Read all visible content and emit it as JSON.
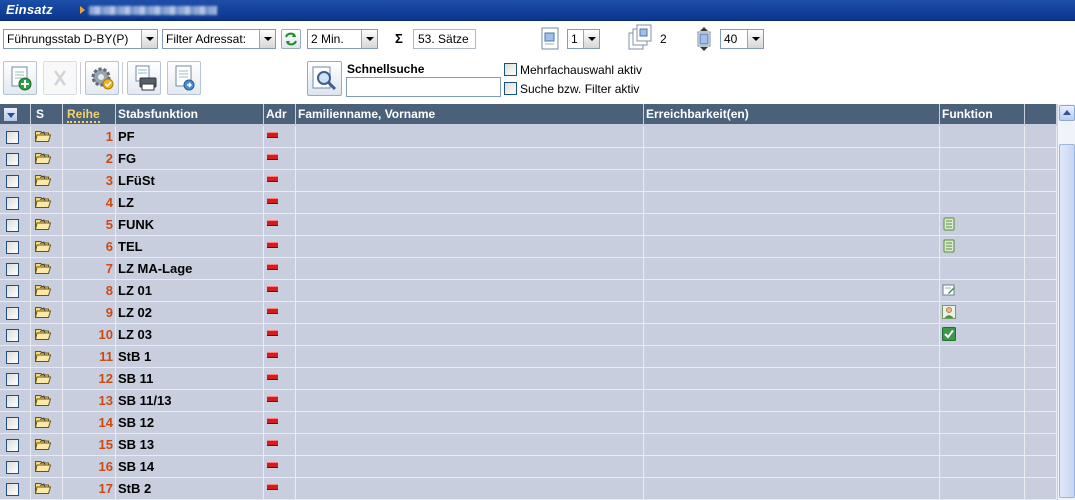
{
  "title_bar": {
    "app_name": "Einsatz"
  },
  "toolbar1": {
    "stab_select": "Führungsstab D-BY(P)",
    "filter_select": "Filter Adressat:",
    "interval_select": "2 Min.",
    "sigma": "Σ",
    "record_count": "53. Sätze",
    "page_select": "1",
    "page_count": "2",
    "rows_per_page_select": "40"
  },
  "toolbar2": {
    "quicksearch_label": "Schnellsuche",
    "quicksearch_value": "",
    "multiselect_label": "Mehrfachauswahl aktiv",
    "filter_active_label": "Suche bzw. Filter aktiv"
  },
  "grid": {
    "headers": {
      "s": "S",
      "reihe": "Reihe",
      "stabsfunktion": "Stabsfunktion",
      "adr": "Adr",
      "name": "Familienname, Vorname",
      "erreichbarkeit": "Erreichbarkeit(en)",
      "funktion": "Funktion"
    },
    "rows": [
      {
        "reihe": "1",
        "stab": "PF",
        "funktion_icon": ""
      },
      {
        "reihe": "2",
        "stab": "FG",
        "funktion_icon": ""
      },
      {
        "reihe": "3",
        "stab": "LFüSt",
        "funktion_icon": ""
      },
      {
        "reihe": "4",
        "stab": "LZ",
        "funktion_icon": ""
      },
      {
        "reihe": "5",
        "stab": "FUNK",
        "funktion_icon": "phone-list-icon"
      },
      {
        "reihe": "6",
        "stab": "TEL",
        "funktion_icon": "phone-list-icon"
      },
      {
        "reihe": "7",
        "stab": "LZ MA-Lage",
        "funktion_icon": ""
      },
      {
        "reihe": "8",
        "stab": "LZ 01",
        "funktion_icon": "edit-note-icon"
      },
      {
        "reihe": "9",
        "stab": "LZ 02",
        "funktion_icon": "person-icon"
      },
      {
        "reihe": "10",
        "stab": "LZ 03",
        "funktion_icon": "checkmark-icon"
      },
      {
        "reihe": "11",
        "stab": "StB 1",
        "funktion_icon": ""
      },
      {
        "reihe": "12",
        "stab": "SB 11",
        "funktion_icon": ""
      },
      {
        "reihe": "13",
        "stab": "SB 11/13",
        "funktion_icon": ""
      },
      {
        "reihe": "14",
        "stab": "SB 12",
        "funktion_icon": ""
      },
      {
        "reihe": "15",
        "stab": "SB 13",
        "funktion_icon": ""
      },
      {
        "reihe": "16",
        "stab": "SB 14",
        "funktion_icon": ""
      },
      {
        "reihe": "17",
        "stab": "StB 2",
        "funktion_icon": ""
      }
    ]
  },
  "colors": {
    "title_bar": "#0b3690",
    "grid_header": "#4a6179",
    "grid_row": "#c8cedd",
    "reihe_text": "#cc4a12",
    "adr_flag": "#d41c1c"
  }
}
